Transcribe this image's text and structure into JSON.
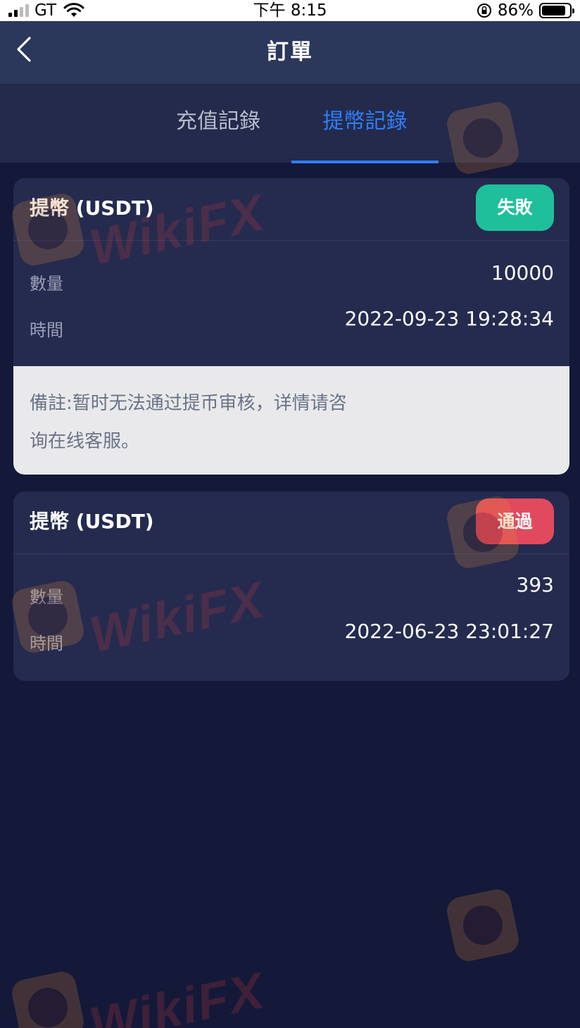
{
  "status_bar": {
    "carrier": "GT",
    "time": "下午 8:15",
    "battery_percent": "86%",
    "battery_level": 0.86,
    "signal_bars": 2,
    "icons": [
      "signal-icon",
      "wifi-icon",
      "orientation-lock-icon",
      "battery-icon"
    ]
  },
  "nav": {
    "title": "訂單",
    "back_icon": "chevron-left-icon"
  },
  "tabs": [
    {
      "label": "充值記錄",
      "active": false
    },
    {
      "label": "提幣記錄",
      "active": true
    }
  ],
  "records": [
    {
      "title": "提幣 (USDT)",
      "status": "失敗",
      "status_color": "#1fbf9b",
      "quantity_label": "數量",
      "quantity": "10000",
      "time_label": "時間",
      "time": "2022-09-23 19:28:34",
      "note_line1": "備註:暂时无法通过提币审核，详情请咨",
      "note_line2": "询在线客服。"
    },
    {
      "title": "提幣 (USDT)",
      "status": "通過",
      "status_color": "#e14a5e",
      "quantity_label": "數量",
      "quantity": "393",
      "time_label": "時間",
      "time": "2022-06-23 23:01:27"
    }
  ],
  "watermark": {
    "text": "WikiFX"
  },
  "colors": {
    "background": "#141939",
    "nav": "#2b375b",
    "tabs": "#232a4c",
    "card": "#252b4f",
    "accent": "#2f7ef6"
  }
}
